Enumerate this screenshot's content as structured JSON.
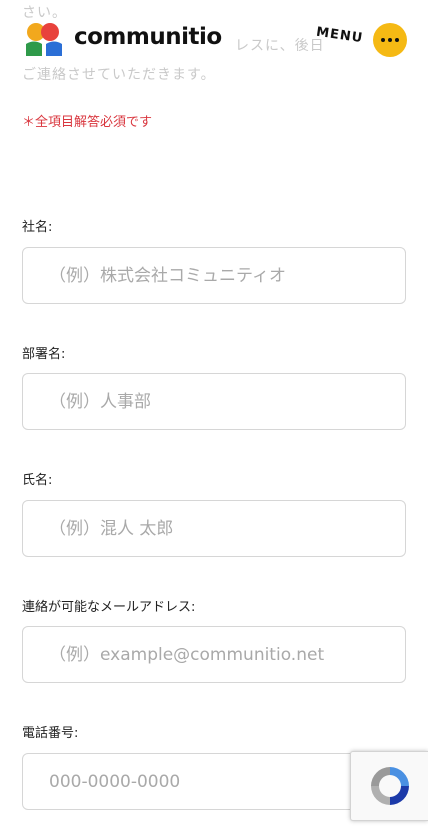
{
  "background_text": {
    "line1": "さい。",
    "line2": "レスに、後日",
    "line3": "ご連絡させていただきます。"
  },
  "header": {
    "brand": "communitio",
    "menu_label": "MENU",
    "menu_button_icon": "ellipsis-icon",
    "accent_color": "#f5b914"
  },
  "form": {
    "required_note": "＊全項目解答必須です",
    "fields": [
      {
        "label": "社名:",
        "placeholder": "（例）株式会社コミュニティオ"
      },
      {
        "label": "部署名:",
        "placeholder": "（例）人事部"
      },
      {
        "label": "氏名:",
        "placeholder": "（例）混人 太郎"
      },
      {
        "label": "連絡が可能なメールアドレス:",
        "placeholder": "（例）example@communitio.net"
      },
      {
        "label": "電話番号:",
        "placeholder": "000-0000-0000"
      }
    ]
  },
  "recaptcha": {
    "icon": "recaptcha-icon"
  }
}
